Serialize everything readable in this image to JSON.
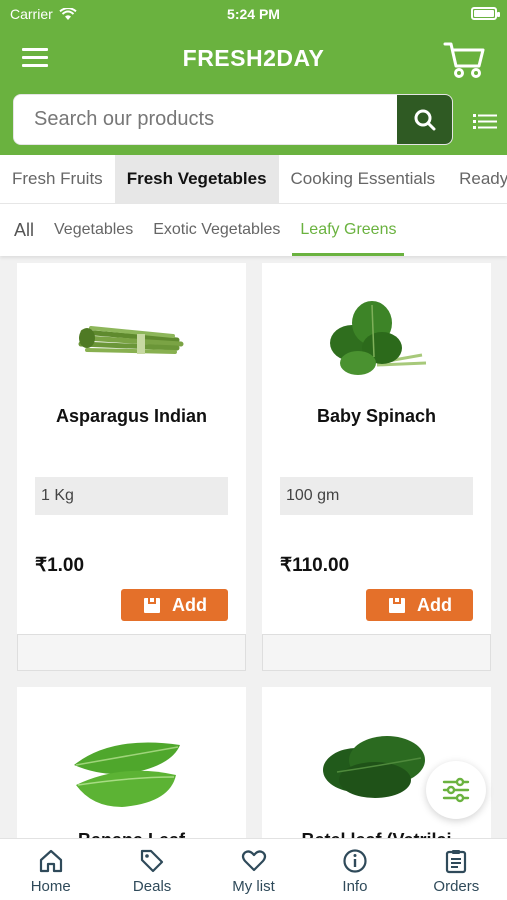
{
  "status_bar": {
    "carrier": "Carrier",
    "time": "5:24 PM"
  },
  "header": {
    "brand": "FRESH2DAY"
  },
  "search": {
    "placeholder": "Search our products"
  },
  "category_tabs": [
    {
      "label": "Fresh Fruits"
    },
    {
      "label": "Fresh Vegetables",
      "active": true
    },
    {
      "label": "Cooking Essentials"
    },
    {
      "label": "Ready to"
    }
  ],
  "sub_tabs": [
    {
      "label": "All"
    },
    {
      "label": "Vegetables"
    },
    {
      "label": "Exotic Vegetables"
    },
    {
      "label": "Leafy Greens",
      "active": true
    }
  ],
  "products": [
    {
      "name": "Asparagus Indian",
      "quantity": "1 Kg",
      "price": "₹1.00",
      "add_label": "Add",
      "image_icon": "asparagus-image"
    },
    {
      "name": "Baby Spinach",
      "quantity": "100 gm",
      "price": "₹110.00",
      "add_label": "Add",
      "image_icon": "spinach-image"
    },
    {
      "name": "Banana Leaf",
      "image_icon": "banana-leaf-image"
    },
    {
      "name": "Betel leaf (Vetrilai",
      "image_icon": "betel-leaf-image"
    }
  ],
  "bottom_nav": [
    {
      "label": "Home",
      "icon": "home-icon"
    },
    {
      "label": "Deals",
      "icon": "tag-icon"
    },
    {
      "label": "My list",
      "icon": "heart-icon"
    },
    {
      "label": "Info",
      "icon": "info-icon"
    },
    {
      "label": "Orders",
      "icon": "clipboard-icon"
    }
  ],
  "colors": {
    "brand_green": "#6ab23f",
    "search_button": "#2f5a23",
    "add_button": "#e4702a"
  }
}
